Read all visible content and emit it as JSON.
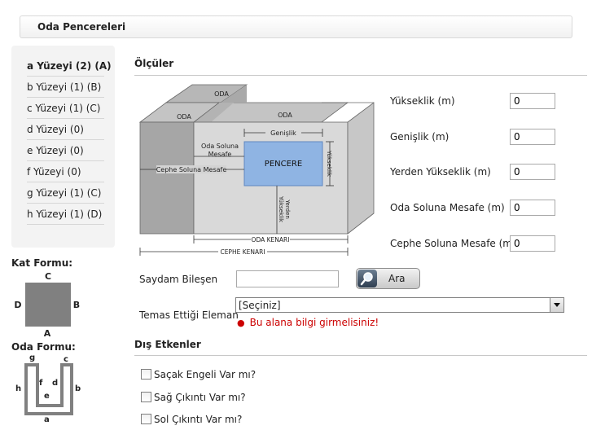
{
  "page": {
    "title": "Oda Pencereleri"
  },
  "surfaces": [
    {
      "label": "a Yüzeyi (2) (A)",
      "active": true
    },
    {
      "label": "b Yüzeyi (1) (B)",
      "active": false
    },
    {
      "label": "c Yüzeyi (1) (C)",
      "active": false
    },
    {
      "label": "d Yüzeyi (0)",
      "active": false
    },
    {
      "label": "e Yüzeyi (0)",
      "active": false
    },
    {
      "label": "f Yüzeyi (0)",
      "active": false
    },
    {
      "label": "g Yüzeyi (1) (C)",
      "active": false
    },
    {
      "label": "h Yüzeyi (1) (D)",
      "active": false
    }
  ],
  "kat_formu": {
    "title": "Kat Formu:",
    "top": "C",
    "left": "D",
    "right": "B",
    "bottom": "A"
  },
  "oda_formu": {
    "title": "Oda Formu:",
    "g": "g",
    "c": "c",
    "h": "h",
    "f": "f",
    "d": "d",
    "b": "b",
    "e": "e",
    "a": "a"
  },
  "measures": {
    "title": "Ölçüler",
    "fields": [
      {
        "label": "Yükseklik (m)",
        "value": "0"
      },
      {
        "label": "Genişlik (m)",
        "value": "0"
      },
      {
        "label": "Yerden Yükseklik (m)",
        "value": "0"
      },
      {
        "label": "Oda Soluna Mesafe (m)",
        "value": "0"
      },
      {
        "label": "Cephe Soluna Mesafe (m)",
        "value": "0"
      }
    ]
  },
  "diagram": {
    "oda_back": "ODA",
    "oda_left": "ODA",
    "oda_front": "ODA",
    "genislik": "Genişlik",
    "oda_soluna_1": "Oda Soluna",
    "oda_soluna_2": "Mesafe",
    "cephe_soluna": "Cephe Soluna Mesafe",
    "pencere": "PENCERE",
    "yukseklik": "Yükseklik",
    "yerden_1": "Yerden",
    "yerden_2": "Yükseklik",
    "oda_kenari": "ODA KENARI",
    "cephe_kenari": "CEPHE KENARI"
  },
  "saydam": {
    "label": "Saydam Bileşen",
    "value": "",
    "button": "Ara"
  },
  "temas": {
    "label": "Temas Ettiği Eleman",
    "selected": "[Seçiniz]",
    "error": "Bu alana bilgi girmelisiniz!"
  },
  "dis_etkenler": {
    "title": "Dış Etkenler",
    "items": [
      {
        "label": "Saçak Engeli Var mı?",
        "checked": false
      },
      {
        "label": "Sağ Çıkıntı Var mı?",
        "checked": false
      },
      {
        "label": "Sol Çıkıntı Var mı?",
        "checked": false
      }
    ]
  },
  "colors": {
    "window": "#8fb4e3",
    "room": "#d9d9d9",
    "error": "#cc0000"
  }
}
